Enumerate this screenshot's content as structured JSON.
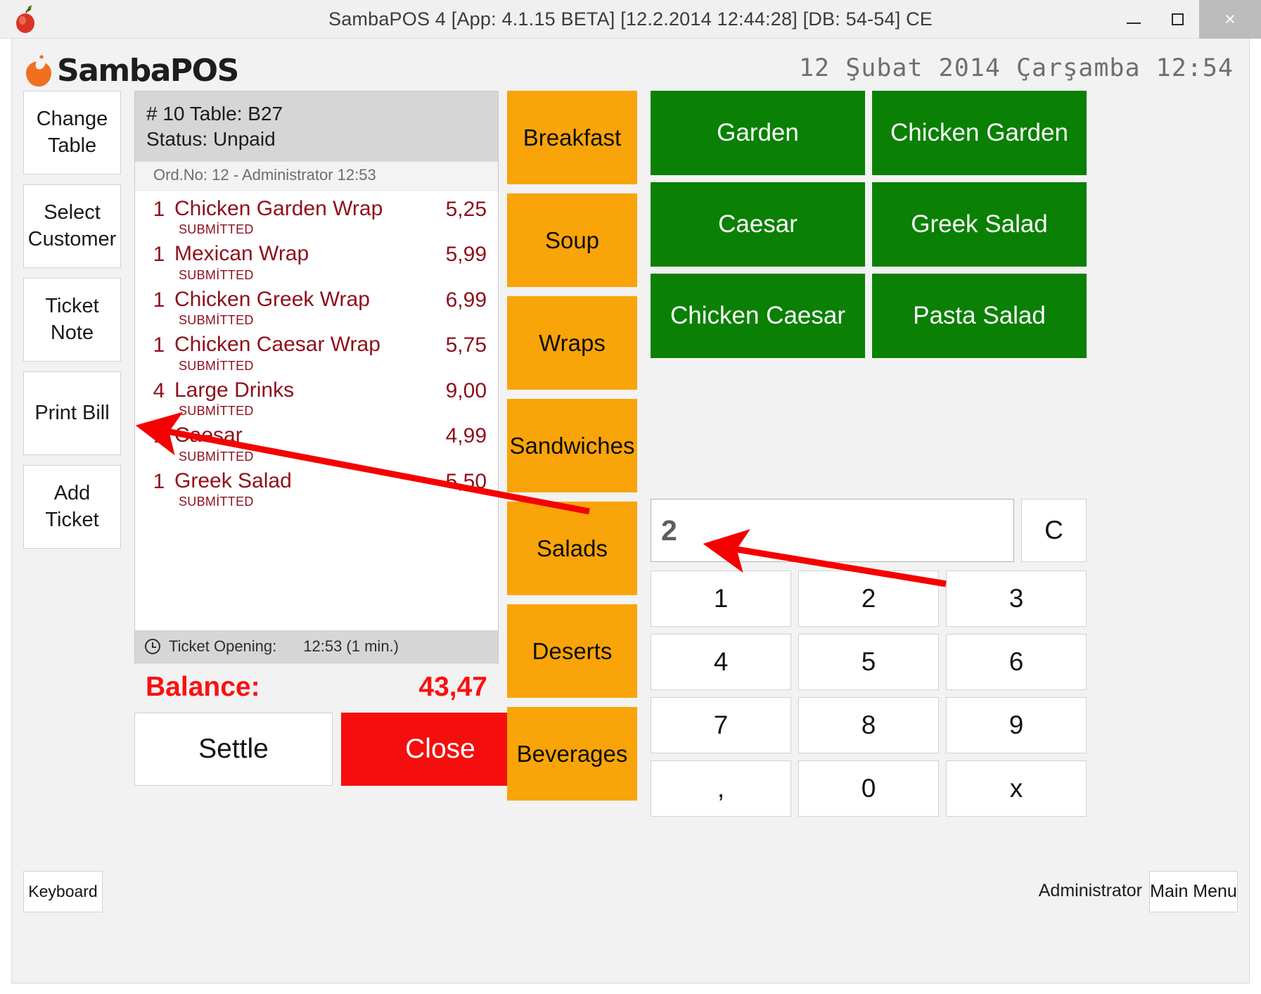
{
  "window": {
    "title": "SambaPOS 4 [App: 4.1.15 BETA] [12.2.2014 12:44:28] [DB: 54-54] CE",
    "minimize_label": "",
    "maximize_label": "",
    "close_label": "×"
  },
  "header": {
    "brand": "SambaPOS",
    "datetime": "12 Şubat 2014 Çarşamba 12:54"
  },
  "left_commands": [
    {
      "label": "Change Table"
    },
    {
      "label": "Select Customer"
    },
    {
      "label": "Ticket Note"
    },
    {
      "label": "Print Bill"
    },
    {
      "label": "Add Ticket"
    }
  ],
  "ticket": {
    "header_line1": "# 10 Table: B27",
    "header_line2": "Status: Unpaid",
    "order_group": "Ord.No: 12 - Administrator  12:53",
    "items": [
      {
        "qty": "1",
        "name": "Chicken Garden Wrap",
        "state": "SUBMİTTED",
        "price": "5,25"
      },
      {
        "qty": "1",
        "name": "Mexican Wrap",
        "state": "SUBMİTTED",
        "price": "5,99"
      },
      {
        "qty": "1",
        "name": "Chicken Greek Wrap",
        "state": "SUBMİTTED",
        "price": "6,99"
      },
      {
        "qty": "1",
        "name": "Chicken Caesar Wrap",
        "state": "SUBMİTTED",
        "price": "5,75"
      },
      {
        "qty": "4",
        "name": "Large Drinks",
        "state": "SUBMİTTED",
        "price": "9,00"
      },
      {
        "qty": "1",
        "name": "Caesar",
        "state": "SUBMİTTED",
        "price": "4,99"
      },
      {
        "qty": "1",
        "name": "Greek Salad",
        "state": "SUBMİTTED",
        "price": "5,50"
      }
    ],
    "footer_label": "Ticket Opening:",
    "footer_value": "12:53 (1 min.)",
    "balance_label": "Balance:",
    "balance_value": "43,47"
  },
  "actions": {
    "settle_label": "Settle",
    "close_label": "Close"
  },
  "categories": [
    {
      "label": "Breakfast"
    },
    {
      "label": "Soup"
    },
    {
      "label": "Wraps"
    },
    {
      "label": "Sandwiches"
    },
    {
      "label": "Salads"
    },
    {
      "label": "Deserts"
    },
    {
      "label": "Beverages"
    }
  ],
  "products": [
    {
      "label": "Garden"
    },
    {
      "label": "Chicken Garden"
    },
    {
      "label": "Caesar"
    },
    {
      "label": "Greek Salad"
    },
    {
      "label": "Chicken Caesar"
    },
    {
      "label": "Pasta Salad"
    }
  ],
  "numpad": {
    "display_value": "2",
    "clear_label": "C",
    "keys": [
      "1",
      "2",
      "3",
      "4",
      "5",
      "6",
      "7",
      "8",
      "9",
      ",",
      "0",
      "x"
    ]
  },
  "statusbar": {
    "keyboard_label": "Keyboard",
    "user_label": "Administrator",
    "main_menu_label": "Main Menu"
  },
  "colors": {
    "category_orange": "#f9a409",
    "product_green": "#0a8004",
    "close_red": "#f60e0e",
    "order_maroon": "#8f0f1a",
    "balance_red": "#fb1010",
    "annotation_red": "#f50000"
  }
}
